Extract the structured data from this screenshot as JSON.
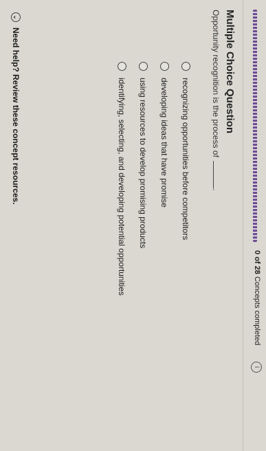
{
  "progress": {
    "completed": "0",
    "total": "28",
    "text_of": "of",
    "text_suffix": "Concepts completed",
    "fraction_done": 0.0
  },
  "info_icon": "i",
  "question": {
    "title": "Multiple Choice Question",
    "prompt": "Opportunity recognition is the process of",
    "prompt_end": "."
  },
  "options": [
    "recognizing opportunities before competitors",
    "developing ideas that have promise",
    "using resources to develop promising products",
    "identifying, selecting, and developing potential opportunities"
  ],
  "help": {
    "icon": "chevron-down-icon",
    "label": "Need help? Review these concept resources."
  },
  "colors": {
    "progress": "#5b3a7c",
    "background": "#dad8d1"
  }
}
